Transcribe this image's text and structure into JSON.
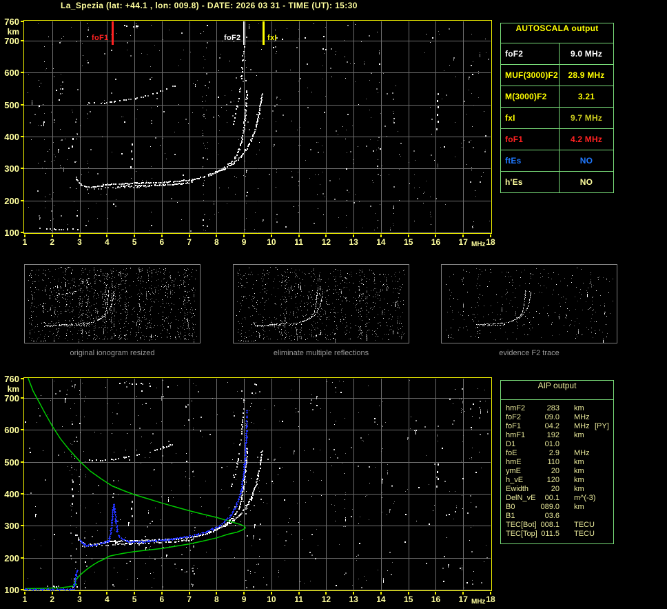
{
  "header": {
    "title": "La_Spezia (lat: +44.1 , lon: 009.8) - DATE: 2026 03 31 - TIME (UT): 15:30"
  },
  "colors": {
    "background": "#000000",
    "title_text": "#ffff9e",
    "axis_text": "#ffff9e",
    "plot_border": "#f2f200",
    "grid": "#6f6f6f",
    "table_border": "#79dd79",
    "autoscala_header": "#ffff00",
    "aip_text": "#e8e89a",
    "caption_text": "#9a9a9a",
    "profile_green": "#00cc00",
    "trace_blue": "#2233ff",
    "echo_white": "#ffffff"
  },
  "axes": {
    "x_ticks": [
      1,
      2,
      3,
      4,
      5,
      6,
      7,
      8,
      9,
      10,
      11,
      12,
      13,
      14,
      15,
      16,
      17,
      18
    ],
    "x_unit": "MHz",
    "y_ticks": [
      760,
      700,
      600,
      500,
      400,
      300,
      200,
      100
    ],
    "y_unit": "km"
  },
  "autoscala_table": {
    "title": "AUTOSCALA output",
    "rows": [
      {
        "label": "foF2",
        "value": "9.0 MHz",
        "label_color": "#ffffff",
        "value_color": "#ffffff"
      },
      {
        "label": "MUF(3000)F2",
        "value": "28.9 MHz",
        "label_color": "#ffff00",
        "value_color": "#ffff00"
      },
      {
        "label": "M(3000)F2",
        "value": "3.21",
        "label_color": "#ffff00",
        "value_color": "#ffff00"
      },
      {
        "label": "fxI",
        "value": "9.7 MHz",
        "label_color": "#ffff00",
        "value_color": "#c9c91f"
      },
      {
        "label": "foF1",
        "value": "4.2 MHz",
        "label_color": "#ff2222",
        "value_color": "#ff2222"
      },
      {
        "label": "ftEs",
        "value": "NO",
        "label_color": "#2079ff",
        "value_color": "#2079ff"
      },
      {
        "label": "h'Es",
        "value": "NO",
        "label_color": "#ffff9e",
        "value_color": "#ffff9e"
      }
    ]
  },
  "aip_table": {
    "title": "AIP output",
    "rows": [
      {
        "label": "hmF2",
        "value": "283",
        "unit": "km",
        "note": ""
      },
      {
        "label": "foF2",
        "value": "09.0",
        "unit": "MHz",
        "note": ""
      },
      {
        "label": "foF1",
        "value": "04.2",
        "unit": "MHz",
        "note": "[PY]"
      },
      {
        "label": "hmF1",
        "value": "192",
        "unit": "km",
        "note": ""
      },
      {
        "label": "D1",
        "value": "01.0",
        "unit": "",
        "note": ""
      },
      {
        "label": "foE",
        "value": "2.9",
        "unit": "MHz",
        "note": ""
      },
      {
        "label": "hmE",
        "value": "110",
        "unit": "km",
        "note": ""
      },
      {
        "label": "ymE",
        "value": "20",
        "unit": "km",
        "note": ""
      },
      {
        "label": "h_vE",
        "value": "120",
        "unit": "km",
        "note": ""
      },
      {
        "label": "Ewidth",
        "value": "20",
        "unit": "km",
        "note": ""
      },
      {
        "label": "DelN_vE",
        "value": "00.1",
        "unit": "m^(-3)",
        "note": ""
      },
      {
        "label": "B0",
        "value": "089.0",
        "unit": "km",
        "note": ""
      },
      {
        "label": "B1",
        "value": "03.6",
        "unit": "",
        "note": ""
      },
      {
        "label": "TEC[Bot]",
        "value": "008.1",
        "unit": "TECU",
        "note": ""
      },
      {
        "label": "TEC[Top]",
        "value": "011.5",
        "unit": "TECU",
        "note": ""
      }
    ]
  },
  "thumbnails": [
    {
      "caption": "original ionogram resized",
      "show": [
        "E-region echo",
        "F-trace",
        "F-trace halo",
        "X-trace",
        "second-hop trace",
        "second-hop asymptote",
        "top-edge dashes",
        "noise streak 2.7MHz"
      ],
      "noise_count": 1250,
      "min_f": 1
    },
    {
      "caption": "eliminate multiple reflections",
      "show": [
        "E-region echo",
        "F-trace",
        "F-trace halo",
        "X-trace",
        "top-edge dashes"
      ],
      "noise_count": 950,
      "min_f": 1
    },
    {
      "caption": "evidence F2 trace",
      "show": [
        "F-trace",
        "X-trace"
      ],
      "noise_count": 320,
      "min_f": 4.3
    }
  ],
  "chart_data": [
    {
      "type": "scatter",
      "title": "ionogram with autoscaled characteristic markers",
      "xlabel": "MHz",
      "ylabel": "km",
      "xlim": [
        1,
        18
      ],
      "ylim": [
        100,
        760
      ],
      "grid": true,
      "markers": [
        {
          "label": "foF1",
          "freq_mhz": 4.2,
          "color": "#ff2222",
          "line": "solid"
        },
        {
          "label": "foF2",
          "freq_mhz": 9.0,
          "color": "#ffffff",
          "line": "double"
        },
        {
          "label": "fxI",
          "freq_mhz": 9.7,
          "color": "#ffff00",
          "line": "solid"
        }
      ],
      "series": [
        {
          "name": "E-region echo",
          "style": "dash",
          "color": "#ffffff",
          "points": [
            [
              1.55,
              114
            ],
            [
              2.05,
              112
            ],
            [
              2.55,
              111
            ],
            [
              2.9,
              111
            ]
          ]
        },
        {
          "name": "F-trace",
          "style": "echo2",
          "color": "#ffffff",
          "points": [
            [
              2.85,
              274
            ],
            [
              2.95,
              258
            ],
            [
              3.05,
              250
            ],
            [
              3.2,
              244
            ],
            [
              3.4,
              242
            ],
            [
              3.7,
              247
            ],
            [
              4.0,
              251
            ],
            [
              4.3,
              253
            ],
            [
              4.7,
              255
            ],
            [
              5.1,
              256
            ],
            [
              5.5,
              257
            ],
            [
              5.9,
              258
            ],
            [
              6.3,
              260
            ],
            [
              6.7,
              263
            ],
            [
              7.1,
              267
            ],
            [
              7.5,
              274
            ],
            [
              7.85,
              284
            ],
            [
              8.15,
              297
            ],
            [
              8.45,
              316
            ],
            [
              8.65,
              336
            ],
            [
              8.8,
              360
            ],
            [
              8.9,
              390
            ],
            [
              8.97,
              425
            ],
            [
              9.02,
              465
            ],
            [
              9.06,
              505
            ],
            [
              9.09,
              545
            ]
          ]
        },
        {
          "name": "F-trace halo",
          "style": "dash",
          "color": "#9a9a9a",
          "points": [
            [
              3.1,
              236
            ],
            [
              3.6,
              239
            ],
            [
              4.2,
              242
            ],
            [
              4.8,
              244
            ],
            [
              5.4,
              245
            ]
          ]
        },
        {
          "name": "X-trace",
          "style": "echo",
          "color": "#ffffff",
          "points": [
            [
              7.7,
              283
            ],
            [
              8.0,
              291
            ],
            [
              8.3,
              302
            ],
            [
              8.6,
              318
            ],
            [
              8.85,
              338
            ],
            [
              9.05,
              360
            ],
            [
              9.25,
              390
            ],
            [
              9.4,
              425
            ],
            [
              9.5,
              462
            ],
            [
              9.58,
              500
            ],
            [
              9.64,
              538
            ]
          ]
        },
        {
          "name": "second-hop trace",
          "style": "dash",
          "color": "#ffffff",
          "points": [
            [
              3.35,
              507
            ],
            [
              3.75,
              505
            ],
            [
              4.15,
              509
            ],
            [
              4.6,
              515
            ],
            [
              5.0,
              521
            ],
            [
              5.4,
              529
            ],
            [
              5.8,
              539
            ],
            [
              6.15,
              549
            ],
            [
              6.45,
              560
            ]
          ]
        },
        {
          "name": "second-hop asymptote",
          "style": "dash",
          "color": "#ffffff",
          "points": [
            [
              8.52,
              420
            ],
            [
              8.63,
              455
            ],
            [
              8.73,
              495
            ],
            [
              8.82,
              540
            ],
            [
              8.89,
              590
            ],
            [
              8.94,
              640
            ],
            [
              8.98,
              695
            ]
          ]
        },
        {
          "name": "top-edge dashes",
          "style": "dash",
          "color": "#ffffff",
          "points": [
            [
              4.35,
              746
            ],
            [
              4.7,
              748
            ],
            [
              5.05,
              745
            ],
            [
              5.35,
              747
            ]
          ]
        },
        {
          "name": "noise streak 16MHz",
          "style": "vdash",
          "color": "#ffffff",
          "points": [
            [
              16.02,
              425
            ],
            [
              16.06,
              450
            ],
            [
              16.03,
              472
            ],
            [
              16.07,
              495
            ],
            [
              16.04,
              515
            ],
            [
              16.06,
              535
            ]
          ]
        },
        {
          "name": "noise streak 2.7MHz",
          "style": "vdash",
          "color": "#cfcfcf",
          "points": [
            [
              2.7,
              372
            ],
            [
              2.73,
              395
            ],
            [
              2.71,
              418
            ],
            [
              2.74,
              440
            ]
          ]
        },
        {
          "name": "noise streak 4.9MHz",
          "style": "vdash",
          "color": "#cfcfcf",
          "points": [
            [
              4.86,
              308
            ],
            [
              4.89,
              332
            ],
            [
              4.87,
              356
            ],
            [
              4.9,
              378
            ]
          ]
        }
      ]
    },
    {
      "type": "scatter",
      "title": "ionogram with restored electron density profile and scaled trace",
      "xlabel": "MHz",
      "ylabel": "km",
      "xlim": [
        1,
        18
      ],
      "ylim": [
        100,
        760
      ],
      "grid": true,
      "echo_series_from": 0,
      "series": [
        {
          "name": "restored profile",
          "style": "line",
          "color": "#00cc00",
          "points": [
            [
              1.12,
              762
            ],
            [
              1.3,
              722
            ],
            [
              1.5,
              690
            ],
            [
              1.75,
              650
            ],
            [
              2.0,
              612
            ],
            [
              2.3,
              572
            ],
            [
              2.6,
              540
            ],
            [
              3.0,
              502
            ],
            [
              3.4,
              470
            ],
            [
              3.8,
              446
            ],
            [
              4.2,
              424
            ],
            [
              4.6,
              410
            ],
            [
              5.0,
              397
            ],
            [
              5.5,
              384
            ],
            [
              6.0,
              371
            ],
            [
              6.5,
              359
            ],
            [
              7.0,
              347
            ],
            [
              7.5,
              336
            ],
            [
              8.0,
              326
            ],
            [
              8.4,
              316
            ],
            [
              8.7,
              308
            ],
            [
              8.9,
              303
            ],
            [
              9.02,
              298
            ],
            [
              9.05,
              293
            ],
            [
              8.95,
              287
            ],
            [
              8.75,
              280
            ],
            [
              8.4,
              273
            ],
            [
              8.0,
              262
            ],
            [
              7.5,
              252
            ],
            [
              7.0,
              243
            ],
            [
              6.5,
              236
            ],
            [
              6.0,
              229
            ],
            [
              5.5,
              224
            ],
            [
              5.0,
              219
            ],
            [
              4.6,
              214
            ],
            [
              4.3,
              209
            ],
            [
              4.1,
              205
            ],
            [
              3.9,
              196
            ],
            [
              3.7,
              188
            ],
            [
              3.5,
              178
            ],
            [
              3.3,
              166
            ],
            [
              3.1,
              152
            ],
            [
              2.95,
              140
            ],
            [
              2.85,
              128
            ],
            [
              2.8,
              120
            ],
            [
              2.88,
              116
            ],
            [
              2.8,
              112
            ],
            [
              2.6,
              109
            ],
            [
              2.3,
              106
            ],
            [
              1.9,
              105
            ],
            [
              1.5,
              104
            ],
            [
              1.0,
              103
            ]
          ]
        },
        {
          "name": "scaled trace E",
          "style": "plus",
          "color": "#2233ff",
          "points": [
            [
              1.0,
              101
            ],
            [
              1.5,
              101
            ],
            [
              2.0,
              101
            ],
            [
              2.4,
              101
            ],
            [
              2.75,
              102
            ]
          ]
        },
        {
          "name": "scaled trace riser",
          "style": "plus",
          "color": "#2233ff",
          "points": [
            [
              2.78,
              104
            ],
            [
              2.81,
              117
            ],
            [
              2.84,
              131
            ],
            [
              2.87,
              146
            ],
            [
              2.91,
              160
            ]
          ]
        },
        {
          "name": "scaled trace F",
          "style": "plus",
          "color": "#2233ff",
          "points": [
            [
              3.02,
              256
            ],
            [
              3.08,
              247
            ],
            [
              3.18,
              241
            ],
            [
              3.3,
              238
            ],
            [
              3.45,
              238
            ],
            [
              3.6,
              241
            ],
            [
              3.75,
              245
            ],
            [
              3.9,
              248
            ],
            [
              4.02,
              252
            ],
            [
              4.09,
              263
            ],
            [
              4.14,
              290
            ],
            [
              4.18,
              322
            ],
            [
              4.21,
              350
            ],
            [
              4.24,
              366
            ],
            [
              4.28,
              345
            ],
            [
              4.32,
              312
            ],
            [
              4.37,
              284
            ],
            [
              4.44,
              267
            ],
            [
              4.55,
              258
            ],
            [
              4.7,
              253
            ],
            [
              4.9,
              250
            ],
            [
              5.2,
              250
            ],
            [
              5.5,
              252
            ],
            [
              5.8,
              254
            ],
            [
              6.1,
              256
            ],
            [
              6.4,
              259
            ],
            [
              6.7,
              263
            ],
            [
              7.0,
              268
            ],
            [
              7.3,
              274
            ],
            [
              7.6,
              281
            ],
            [
              7.85,
              290
            ],
            [
              8.1,
              301
            ],
            [
              8.3,
              315
            ],
            [
              8.5,
              333
            ],
            [
              8.67,
              355
            ],
            [
              8.8,
              381
            ],
            [
              8.9,
              413
            ],
            [
              8.97,
              450
            ],
            [
              9.02,
              492
            ],
            [
              9.05,
              535
            ],
            [
              9.07,
              578
            ],
            [
              9.09,
              622
            ],
            [
              9.1,
              660
            ]
          ]
        }
      ]
    }
  ]
}
